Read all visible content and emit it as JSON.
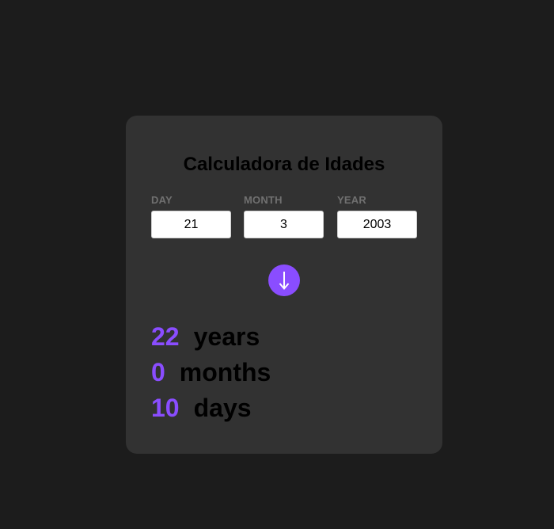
{
  "card": {
    "title": "Calculadora de Idades"
  },
  "form": {
    "day": {
      "label": "DAY",
      "value": "21"
    },
    "month": {
      "label": "MONTH",
      "value": "3"
    },
    "year": {
      "label": "YEAR",
      "value": "2003"
    },
    "submit_icon": "arrow-down-icon"
  },
  "results": {
    "years": {
      "value": "22",
      "unit": "years"
    },
    "months": {
      "value": "0",
      "unit": "months"
    },
    "days": {
      "value": "10",
      "unit": "days"
    }
  },
  "colors": {
    "background": "#1c1c1c",
    "card": "#323232",
    "accent": "#8a4dff",
    "label": "#707070"
  }
}
